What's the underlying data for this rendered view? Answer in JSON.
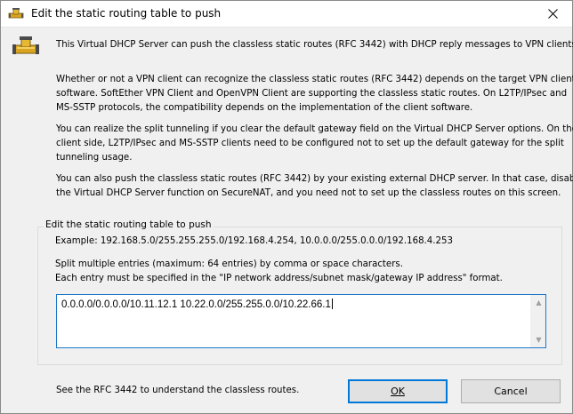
{
  "window": {
    "title": "Edit the static routing table to push"
  },
  "icons": {
    "app": "network-pipe-icon",
    "dialog": "network-pipe-icon",
    "close": "close-icon"
  },
  "intro": {
    "line1": "This Virtual DHCP Server can push the classless static routes (RFC 3442) with DHCP reply messages to VPN clients.",
    "p2_l1": "Whether or not a VPN client can recognize the classless static routes (RFC 3442) depends on the target VPN client",
    "p2_l2": "software. SoftEther VPN Client and OpenVPN Client are supporting the classless static routes. On L2TP/IPsec and",
    "p2_l3": "MS-SSTP protocols, the compatibility depends on the implementation of the client software.",
    "p3_l1": "You can realize the split tunneling if you clear the default gateway field on the Virtual DHCP Server options. On the",
    "p3_l2": "client side, L2TP/IPsec and MS-SSTP clients need to be configured not to set up the default gateway for the split",
    "p3_l3": "tunneling usage.",
    "p4_l1": "You can also push the classless static routes (RFC 3442) by your existing external DHCP server. In that case, disable",
    "p4_l2": "the Virtual DHCP Server function on SecureNAT, and you need not to set up the classless routes on this screen."
  },
  "group": {
    "legend": "Edit the static routing table to push",
    "example": "Example: 192.168.5.0/255.255.255.0/192.168.4.254, 10.0.0.0/255.0.0.0/192.168.4.253",
    "hint1": "Split multiple entries (maximum: 64 entries) by comma or space characters.",
    "hint2": "Each entry must be specified in the \"IP network address/subnet mask/gateway IP address\" format.",
    "routes_value": "0.0.0.0/0.0.0.0/10.11.12.1 10.22.0.0/255.255.0.0/10.22.66.1"
  },
  "footer": {
    "note": "See the RFC 3442 to understand the classless routes.",
    "ok_label": "OK",
    "cancel_label": "Cancel"
  },
  "colors": {
    "accent": "#0078d7",
    "icon_gold": "#d9a520"
  }
}
